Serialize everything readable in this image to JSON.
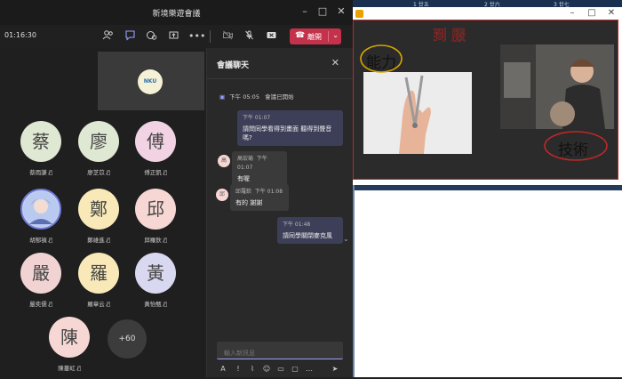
{
  "window": {
    "title": "新境樂遊會議"
  },
  "toolbar": {
    "elapsed": "01:16:30",
    "leave_label": "離開"
  },
  "self_view": {
    "logo_text": "NKU"
  },
  "participants": [
    {
      "initial": "蔡",
      "name": "蔡雨謙",
      "bg": "#dfe8d2",
      "fg": "#444"
    },
    {
      "initial": "廖",
      "name": "廖芝苡",
      "bg": "#dfe8d2",
      "fg": "#444"
    },
    {
      "initial": "傅",
      "name": "傅正凱",
      "bg": "#f1d3e3",
      "fg": "#444"
    },
    {
      "initial": "",
      "name": "胡郁禎",
      "bg": "#c9d6f5",
      "fg": "#444"
    },
    {
      "initial": "鄭",
      "name": "鄭維進",
      "bg": "#f9e9b8",
      "fg": "#444"
    },
    {
      "initial": "邱",
      "name": "邱羅欽",
      "bg": "#f6d7d4",
      "fg": "#444"
    },
    {
      "initial": "嚴",
      "name": "嚴奕儒",
      "bg": "#f1d3d3",
      "fg": "#444"
    },
    {
      "initial": "羅",
      "name": "羅章云",
      "bg": "#f9e9b8",
      "fg": "#444"
    },
    {
      "initial": "黃",
      "name": "黃怡甄",
      "bg": "#d9d8f1",
      "fg": "#444"
    },
    {
      "initial": "陳",
      "name": "陳蔓虹",
      "bg": "#f6d7d4",
      "fg": "#444"
    }
  ],
  "more_count": "+60",
  "chat": {
    "header": "會議聊天",
    "system": {
      "time": "下午 05:05",
      "text": "會議已開始"
    },
    "messages": [
      {
        "id": "m1",
        "mine": true,
        "meta": "下午 01:07",
        "text": "請問同學看得到畫面 聽得到聲音嗎?"
      },
      {
        "id": "m2",
        "mine": false,
        "avatar": "高",
        "sender": "高宏瑜",
        "meta": "下午 01:07",
        "text": "有喔"
      },
      {
        "id": "m3",
        "mine": false,
        "avatar": "邱",
        "sender": "邱羅欽",
        "meta": "下午 01:08",
        "text": "有的 謝謝"
      },
      {
        "id": "m4",
        "mine": true,
        "meta": "下午 01:48",
        "text": "請同學關閉麥克風"
      }
    ],
    "compose_placeholder": "輸入新訊息"
  },
  "slide": {
    "annotation_left": "能力",
    "annotation_top": "到 服",
    "annotation_right": "技術"
  },
  "taskbar": {
    "items": [
      "1 廿五",
      "2 廿六",
      "3 廿七"
    ]
  }
}
